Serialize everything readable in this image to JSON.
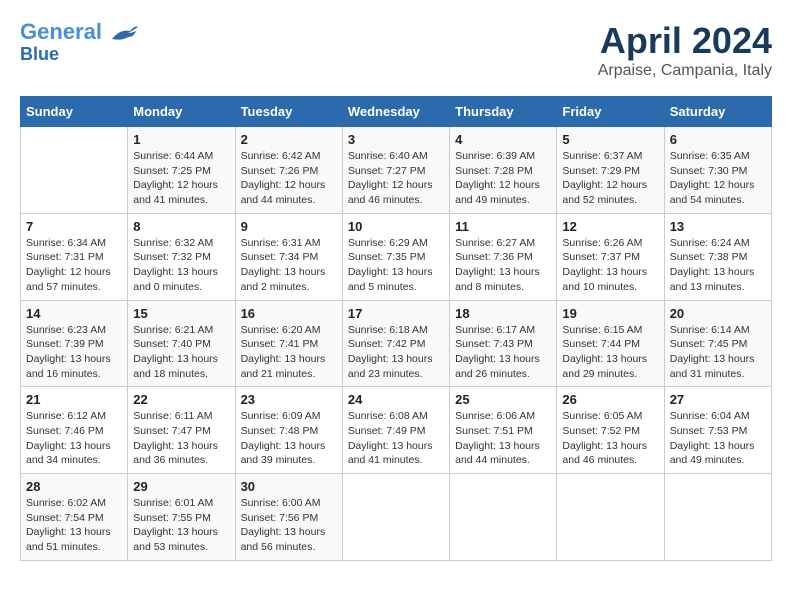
{
  "header": {
    "logo_line1": "General",
    "logo_line2": "Blue",
    "title": "April 2024",
    "subtitle": "Arpaise, Campania, Italy"
  },
  "calendar": {
    "days_of_week": [
      "Sunday",
      "Monday",
      "Tuesday",
      "Wednesday",
      "Thursday",
      "Friday",
      "Saturday"
    ],
    "weeks": [
      [
        {
          "day": "",
          "info": ""
        },
        {
          "day": "1",
          "info": "Sunrise: 6:44 AM\nSunset: 7:25 PM\nDaylight: 12 hours\nand 41 minutes."
        },
        {
          "day": "2",
          "info": "Sunrise: 6:42 AM\nSunset: 7:26 PM\nDaylight: 12 hours\nand 44 minutes."
        },
        {
          "day": "3",
          "info": "Sunrise: 6:40 AM\nSunset: 7:27 PM\nDaylight: 12 hours\nand 46 minutes."
        },
        {
          "day": "4",
          "info": "Sunrise: 6:39 AM\nSunset: 7:28 PM\nDaylight: 12 hours\nand 49 minutes."
        },
        {
          "day": "5",
          "info": "Sunrise: 6:37 AM\nSunset: 7:29 PM\nDaylight: 12 hours\nand 52 minutes."
        },
        {
          "day": "6",
          "info": "Sunrise: 6:35 AM\nSunset: 7:30 PM\nDaylight: 12 hours\nand 54 minutes."
        }
      ],
      [
        {
          "day": "7",
          "info": "Sunrise: 6:34 AM\nSunset: 7:31 PM\nDaylight: 12 hours\nand 57 minutes."
        },
        {
          "day": "8",
          "info": "Sunrise: 6:32 AM\nSunset: 7:32 PM\nDaylight: 13 hours\nand 0 minutes."
        },
        {
          "day": "9",
          "info": "Sunrise: 6:31 AM\nSunset: 7:34 PM\nDaylight: 13 hours\nand 2 minutes."
        },
        {
          "day": "10",
          "info": "Sunrise: 6:29 AM\nSunset: 7:35 PM\nDaylight: 13 hours\nand 5 minutes."
        },
        {
          "day": "11",
          "info": "Sunrise: 6:27 AM\nSunset: 7:36 PM\nDaylight: 13 hours\nand 8 minutes."
        },
        {
          "day": "12",
          "info": "Sunrise: 6:26 AM\nSunset: 7:37 PM\nDaylight: 13 hours\nand 10 minutes."
        },
        {
          "day": "13",
          "info": "Sunrise: 6:24 AM\nSunset: 7:38 PM\nDaylight: 13 hours\nand 13 minutes."
        }
      ],
      [
        {
          "day": "14",
          "info": "Sunrise: 6:23 AM\nSunset: 7:39 PM\nDaylight: 13 hours\nand 16 minutes."
        },
        {
          "day": "15",
          "info": "Sunrise: 6:21 AM\nSunset: 7:40 PM\nDaylight: 13 hours\nand 18 minutes."
        },
        {
          "day": "16",
          "info": "Sunrise: 6:20 AM\nSunset: 7:41 PM\nDaylight: 13 hours\nand 21 minutes."
        },
        {
          "day": "17",
          "info": "Sunrise: 6:18 AM\nSunset: 7:42 PM\nDaylight: 13 hours\nand 23 minutes."
        },
        {
          "day": "18",
          "info": "Sunrise: 6:17 AM\nSunset: 7:43 PM\nDaylight: 13 hours\nand 26 minutes."
        },
        {
          "day": "19",
          "info": "Sunrise: 6:15 AM\nSunset: 7:44 PM\nDaylight: 13 hours\nand 29 minutes."
        },
        {
          "day": "20",
          "info": "Sunrise: 6:14 AM\nSunset: 7:45 PM\nDaylight: 13 hours\nand 31 minutes."
        }
      ],
      [
        {
          "day": "21",
          "info": "Sunrise: 6:12 AM\nSunset: 7:46 PM\nDaylight: 13 hours\nand 34 minutes."
        },
        {
          "day": "22",
          "info": "Sunrise: 6:11 AM\nSunset: 7:47 PM\nDaylight: 13 hours\nand 36 minutes."
        },
        {
          "day": "23",
          "info": "Sunrise: 6:09 AM\nSunset: 7:48 PM\nDaylight: 13 hours\nand 39 minutes."
        },
        {
          "day": "24",
          "info": "Sunrise: 6:08 AM\nSunset: 7:49 PM\nDaylight: 13 hours\nand 41 minutes."
        },
        {
          "day": "25",
          "info": "Sunrise: 6:06 AM\nSunset: 7:51 PM\nDaylight: 13 hours\nand 44 minutes."
        },
        {
          "day": "26",
          "info": "Sunrise: 6:05 AM\nSunset: 7:52 PM\nDaylight: 13 hours\nand 46 minutes."
        },
        {
          "day": "27",
          "info": "Sunrise: 6:04 AM\nSunset: 7:53 PM\nDaylight: 13 hours\nand 49 minutes."
        }
      ],
      [
        {
          "day": "28",
          "info": "Sunrise: 6:02 AM\nSunset: 7:54 PM\nDaylight: 13 hours\nand 51 minutes."
        },
        {
          "day": "29",
          "info": "Sunrise: 6:01 AM\nSunset: 7:55 PM\nDaylight: 13 hours\nand 53 minutes."
        },
        {
          "day": "30",
          "info": "Sunrise: 6:00 AM\nSunset: 7:56 PM\nDaylight: 13 hours\nand 56 minutes."
        },
        {
          "day": "",
          "info": ""
        },
        {
          "day": "",
          "info": ""
        },
        {
          "day": "",
          "info": ""
        },
        {
          "day": "",
          "info": ""
        }
      ]
    ]
  }
}
